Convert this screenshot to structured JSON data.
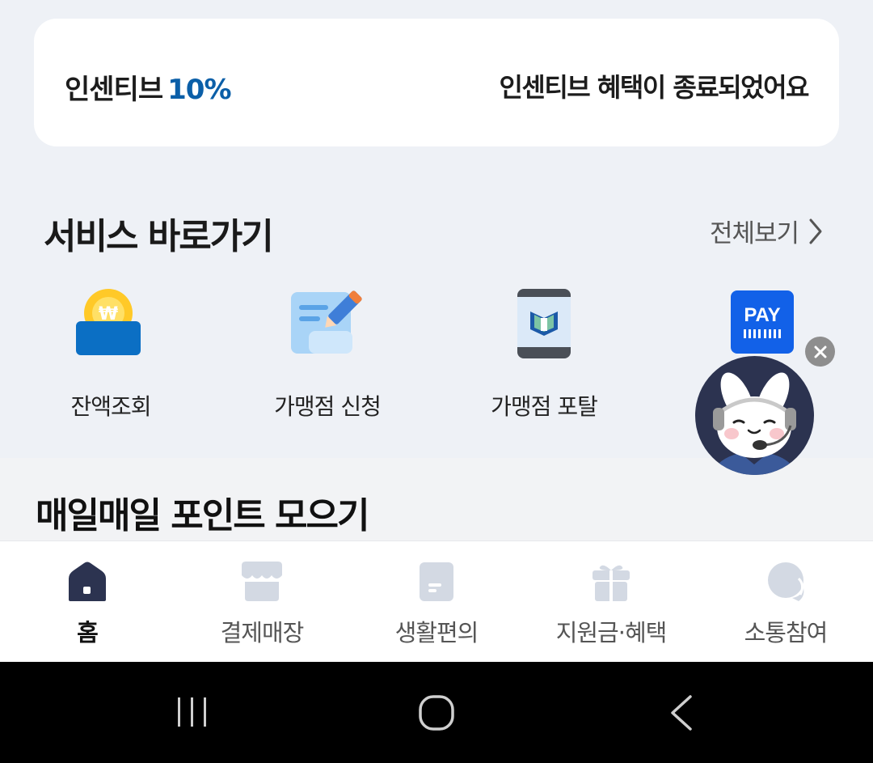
{
  "incentive": {
    "label": "인센티브",
    "percent": "10%",
    "status": "인센티브 혜택이 종료되었어요"
  },
  "services": {
    "title": "서비스 바로가기",
    "view_all": "전체보기",
    "items": [
      {
        "label": "잔액조회",
        "icon": "coin-wallet-icon"
      },
      {
        "label": "가맹점 신청",
        "icon": "document-pencil-icon"
      },
      {
        "label": "가맹점 포탈",
        "icon": "phone-portal-icon"
      },
      {
        "label": "",
        "icon": "pay-icon",
        "icon_text": "PAY"
      }
    ]
  },
  "points": {
    "title": "매일매일 포인트 모으기"
  },
  "bottom_nav": {
    "items": [
      {
        "label": "홈",
        "icon": "home-icon",
        "active": true
      },
      {
        "label": "결제매장",
        "icon": "store-icon",
        "active": false
      },
      {
        "label": "생활편의",
        "icon": "note-icon",
        "active": false
      },
      {
        "label": "지원금·혜택",
        "icon": "gift-icon",
        "active": false
      },
      {
        "label": "소통참여",
        "icon": "chat-bubble-icon",
        "active": false
      }
    ]
  },
  "colors": {
    "accent": "#0b5fa8",
    "background": "#eef1f6",
    "nav_active": "#2c3350",
    "nav_inactive": "#d3d9e3"
  }
}
